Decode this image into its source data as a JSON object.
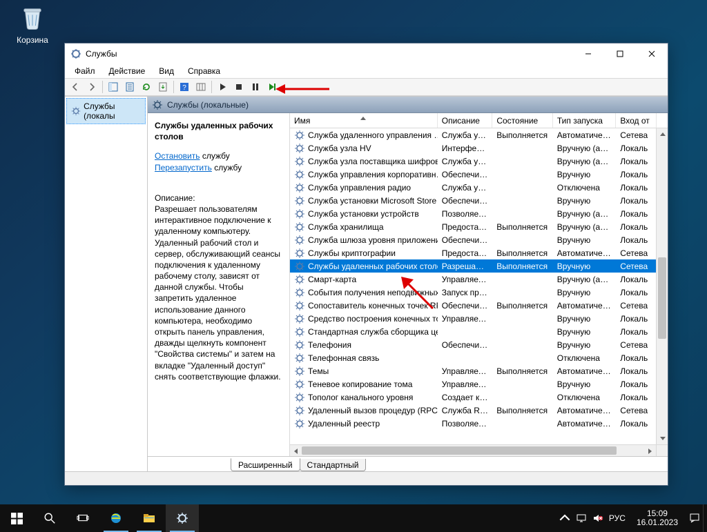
{
  "desktop": {
    "recycle_bin_label": "Корзина"
  },
  "window": {
    "title": "Службы",
    "menu": {
      "file": "Файл",
      "action": "Действие",
      "view": "Вид",
      "help": "Справка"
    },
    "left_tree_item": "Службы (локалы",
    "pane_header": "Службы (локальные)",
    "tabs": {
      "extended": "Расширенный",
      "standard": "Стандартный",
      "active": "extended"
    }
  },
  "detail": {
    "title": "Службы удаленных рабочих столов",
    "stop_link": "Остановить",
    "stop_suffix": " службу",
    "restart_link": "Перезапустить",
    "restart_suffix": " службу",
    "desc_label": "Описание:",
    "description": "Разрешает пользователям интерактивное подключение к удаленному компьютеру. Удаленный рабочий стол и сервер, обслуживающий сеансы подключения к удаленному рабочему столу, зависят от данной службы. Чтобы запретить удаленное использование данного компьютера, необходимо открыть панель управления, дважды щелкнуть компонент \"Свойства системы\" и затем на вкладке \"Удаленный доступ\" снять соответствующие флажки."
  },
  "columns": {
    "name": "Имя",
    "desc": "Описание",
    "state": "Состояние",
    "start": "Тип запуска",
    "logon": "Вход от"
  },
  "col_widths": {
    "name": 215,
    "desc": 80,
    "state": 88,
    "start": 92,
    "logon": 58
  },
  "services": [
    {
      "name": "Служба удаленного управления …",
      "desc": "Служба уд…",
      "state": "Выполняется",
      "start": "Автоматиче…",
      "logon": "Сетева"
    },
    {
      "name": "Служба узла HV",
      "desc": "Интерфей…",
      "state": "",
      "start": "Вручную (ак…",
      "logon": "Локаль"
    },
    {
      "name": "Служба узла поставщика шифров…",
      "desc": "Служба уз…",
      "state": "",
      "start": "Вручную (ак…",
      "logon": "Локаль"
    },
    {
      "name": "Служба управления корпоративн…",
      "desc": "Обеспечи…",
      "state": "",
      "start": "Вручную",
      "logon": "Локаль"
    },
    {
      "name": "Служба управления радио",
      "desc": "Служба уп…",
      "state": "",
      "start": "Отключена",
      "logon": "Локаль"
    },
    {
      "name": "Служба установки Microsoft Store",
      "desc": "Обеспечи…",
      "state": "",
      "start": "Вручную",
      "logon": "Локаль"
    },
    {
      "name": "Служба установки устройств",
      "desc": "Позволяет…",
      "state": "",
      "start": "Вручную (ак…",
      "logon": "Локаль"
    },
    {
      "name": "Служба хранилища",
      "desc": "Предостав…",
      "state": "Выполняется",
      "start": "Вручную (ак…",
      "logon": "Локаль"
    },
    {
      "name": "Служба шлюза уровня приложения",
      "desc": "Обеспечи…",
      "state": "",
      "start": "Вручную",
      "logon": "Локаль"
    },
    {
      "name": "Службы криптографии",
      "desc": "Предостав…",
      "state": "Выполняется",
      "start": "Автоматиче…",
      "logon": "Сетева"
    },
    {
      "name": "Службы удаленных рабочих столов",
      "desc": "Разрешает…",
      "state": "Выполняется",
      "start": "Вручную",
      "logon": "Сетева",
      "selected": true
    },
    {
      "name": "Смарт-карта",
      "desc": "Управляет…",
      "state": "",
      "start": "Вручную (ак…",
      "logon": "Локаль"
    },
    {
      "name": "События получения неподвижных…",
      "desc": "Запуск пр…",
      "state": "",
      "start": "Вручную",
      "logon": "Локаль"
    },
    {
      "name": "Сопоставитель конечных точек RPC",
      "desc": "Обеспечи…",
      "state": "Выполняется",
      "start": "Автоматиче…",
      "logon": "Сетева"
    },
    {
      "name": "Средство построения конечных то…",
      "desc": "Управляет…",
      "state": "",
      "start": "Вручную",
      "logon": "Локаль"
    },
    {
      "name": "Стандартная служба сборщика це…",
      "desc": "",
      "state": "",
      "start": "Вручную",
      "logon": "Локаль"
    },
    {
      "name": "Телефония",
      "desc": "Обеспечи…",
      "state": "",
      "start": "Вручную",
      "logon": "Сетева"
    },
    {
      "name": "Телефонная связь",
      "desc": "",
      "state": "",
      "start": "Отключена",
      "logon": "Локаль"
    },
    {
      "name": "Темы",
      "desc": "Управляет…",
      "state": "Выполняется",
      "start": "Автоматиче…",
      "logon": "Локаль"
    },
    {
      "name": "Теневое копирование тома",
      "desc": "Управляет…",
      "state": "",
      "start": "Вручную",
      "logon": "Локаль"
    },
    {
      "name": "Тополог канального уровня",
      "desc": "Создает ка…",
      "state": "",
      "start": "Отключена",
      "logon": "Локаль"
    },
    {
      "name": "Удаленный вызов процедур (RPC)",
      "desc": "Служба R…",
      "state": "Выполняется",
      "start": "Автоматиче…",
      "logon": "Сетева"
    },
    {
      "name": "Удаленный реестр",
      "desc": "Позволяет…",
      "state": "",
      "start": "Автоматиче…",
      "logon": "Локаль"
    }
  ],
  "taskbar": {
    "lang": "РУС",
    "time": "15:09",
    "date": "16.01.2023"
  }
}
